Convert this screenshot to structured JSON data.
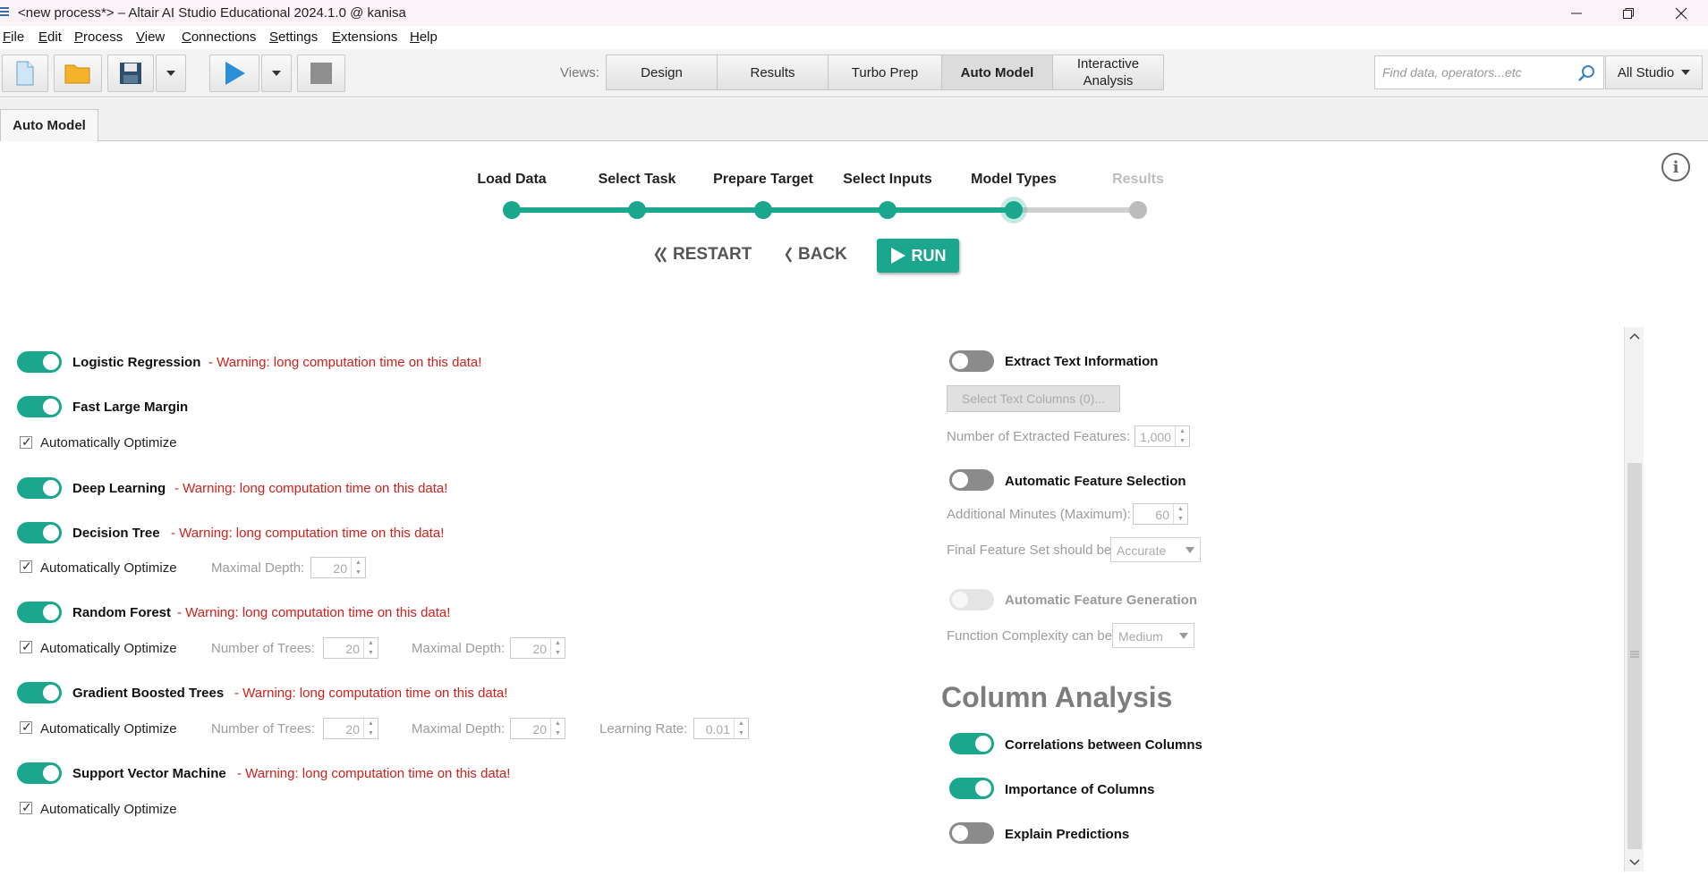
{
  "window": {
    "title": "<new process*> – Altair AI Studio Educational 2024.1.0 @ kanisa"
  },
  "menu": {
    "items": [
      {
        "first": "F",
        "rest": "ile"
      },
      {
        "first": "E",
        "rest": "dit"
      },
      {
        "first": "P",
        "rest": "rocess"
      },
      {
        "first": "V",
        "rest": "iew"
      },
      {
        "first": "C",
        "rest": "onnections"
      },
      {
        "first": "S",
        "rest": "ettings"
      },
      {
        "first": "E",
        "rest": "xtensions"
      },
      {
        "first": "H",
        "rest": "elp"
      }
    ]
  },
  "toolbar": {
    "views_label": "Views:",
    "views": [
      "Design",
      "Results",
      "Turbo Prep",
      "Auto Model",
      "Interactive Analysis"
    ],
    "active_view": "Auto Model",
    "search_placeholder": "Find data, operators...etc",
    "studio_selector": "All Studio"
  },
  "panel_tab": "Auto Model",
  "stepper": {
    "steps": [
      "Load Data",
      "Select Task",
      "Prepare Target",
      "Select Inputs",
      "Model Types",
      "Results"
    ],
    "current_step": "Model Types",
    "restart_label": "RESTART",
    "back_label": "BACK",
    "run_label": "RUN",
    "accent_color": "#1ba68e"
  },
  "models": {
    "warning_text": "- Warning: long computation time on this data!",
    "optimize_label": "Automatically Optimize",
    "max_depth_label": "Maximal Depth:",
    "num_trees_label": "Number of Trees:",
    "learning_rate_label": "Learning Rate:",
    "logistic_regression": "Logistic Regression",
    "fast_large_margin": "Fast Large Margin",
    "deep_learning": "Deep Learning",
    "decision_tree": "Decision Tree",
    "decision_tree_depth": "20",
    "random_forest": "Random Forest",
    "random_forest_trees": "20",
    "random_forest_depth": "20",
    "gradient_boosted_trees": "Gradient Boosted Trees",
    "gbt_trees": "20",
    "gbt_depth": "20",
    "gbt_learning_rate": "0.01",
    "support_vector_machine": "Support Vector Machine"
  },
  "feature_engineering": {
    "extract_text": "Extract Text Information",
    "select_text_columns": "Select Text Columns (0)...",
    "num_extracted_label": "Number of Extracted Features:",
    "num_extracted_value": "1,000",
    "auto_feature_selection": "Automatic Feature Selection",
    "additional_minutes_label": "Additional Minutes (Maximum):",
    "additional_minutes_value": "60",
    "final_feature_set_label": "Final Feature Set should be",
    "final_feature_set_value": "Accurate",
    "auto_feature_generation": "Automatic Feature Generation",
    "function_complexity_label": "Function Complexity can be",
    "function_complexity_value": "Medium"
  },
  "column_analysis": {
    "title": "Column Analysis",
    "correlations": "Correlations between Columns",
    "importance": "Importance of Columns",
    "explain": "Explain Predictions"
  }
}
